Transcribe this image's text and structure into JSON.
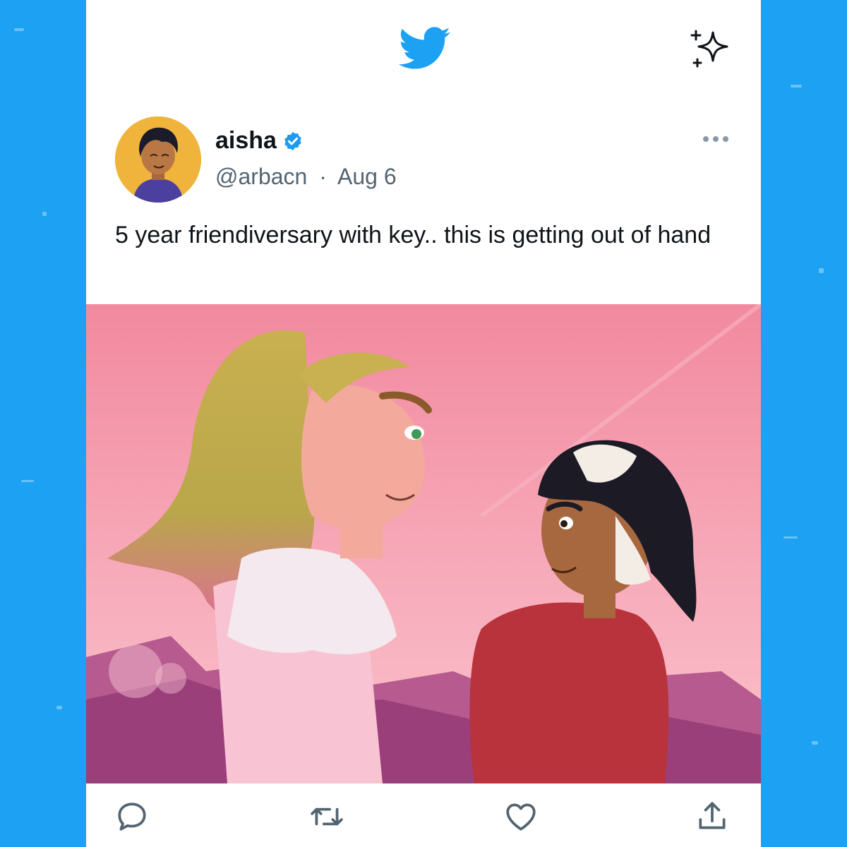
{
  "brand": {
    "accent": "#1da1f2",
    "logo_icon": "twitter-bird-icon",
    "top_action_icon": "sparkle-icon"
  },
  "tweet": {
    "display_name": "aisha",
    "verified_icon": "verified-badge-icon",
    "handle": "@arbacn",
    "separator": "·",
    "date": "Aug 6",
    "text": "5 year friendiversary with key.. this is getting out of hand",
    "media_description_icon": "illustration-image"
  },
  "actions": [
    {
      "name": "reply",
      "icon": "reply-icon"
    },
    {
      "name": "retweet",
      "icon": "retweet-icon"
    },
    {
      "name": "like",
      "icon": "heart-icon"
    },
    {
      "name": "share",
      "icon": "share-icon"
    }
  ]
}
